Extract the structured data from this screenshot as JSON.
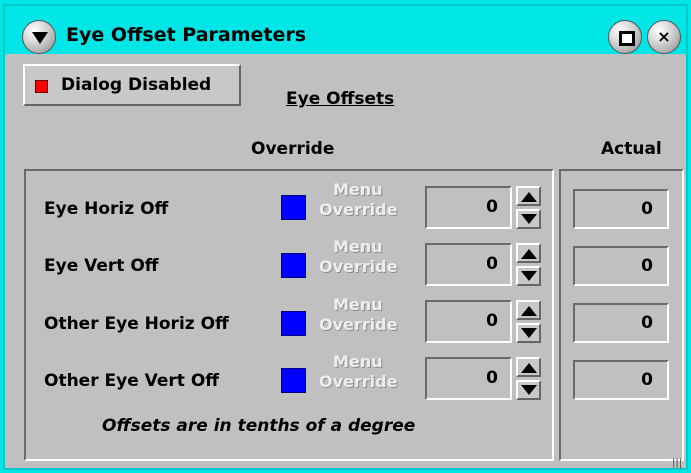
{
  "window": {
    "title": "Eye Offset Parameters"
  },
  "toolbar": {
    "dialog_disabled_label": "Dialog Disabled",
    "dialog_disabled_color": "#ff0000"
  },
  "section": {
    "title": "Eye Offsets"
  },
  "columns": {
    "override": "Override",
    "actual": "Actual"
  },
  "rows": [
    {
      "label": "Eye Horiz Off",
      "menu_line1": "Menu",
      "menu_line2": "Override",
      "value": "0",
      "actual": "0"
    },
    {
      "label": "Eye Vert Off",
      "menu_line1": "Menu",
      "menu_line2": "Override",
      "value": "0",
      "actual": "0"
    },
    {
      "label": "Other Eye Horiz Off",
      "menu_line1": "Menu",
      "menu_line2": "Override",
      "value": "0",
      "actual": "0"
    },
    {
      "label": "Other Eye Vert Off",
      "menu_line1": "Menu",
      "menu_line2": "Override",
      "value": "0",
      "actual": "0"
    }
  ],
  "footnote": "Offsets are in tenths of a degree",
  "colors": {
    "titlebar": "#00e5e5",
    "body": "#c0c0c0",
    "override_toggle": "#0000ff"
  },
  "icons": {
    "menu": "triangle-down-icon",
    "maximize": "maximize-icon",
    "close": "close-icon"
  }
}
